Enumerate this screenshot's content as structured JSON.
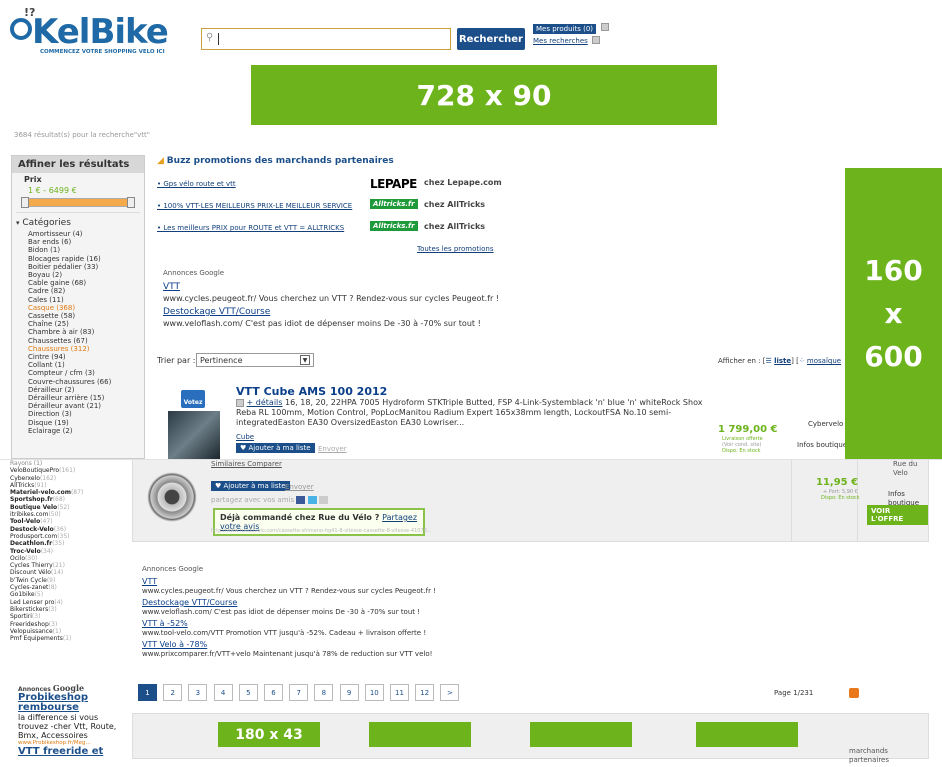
{
  "header": {
    "logo_text": "KelBike",
    "tagline": "COMMENCEZ VOTRE SHOPPING VELO ICI",
    "search_value": "",
    "search_button": "Rechercher",
    "my_products": "Mes produits (0)",
    "my_searches": "Mes recherches"
  },
  "ads": {
    "top_banner": "728 x 90",
    "sky_160": "160",
    "sky_x": "x",
    "sky_600": "600",
    "bottom_banner": "180 x 43"
  },
  "results_count": "3684 résultat(s) pour la recherche\"vtt\"",
  "sidebar": {
    "refine_title": "Affiner les résultats",
    "price_label": "Prix",
    "price_range": "1 € - 6499 €",
    "categories_title": "Catégories",
    "categories": [
      {
        "label": "Amortisseur (4)",
        "hl": false
      },
      {
        "label": "Bar ends (6)",
        "hl": false
      },
      {
        "label": "Bidon (1)",
        "hl": false
      },
      {
        "label": "Blocages rapide (16)",
        "hl": false
      },
      {
        "label": "Boitier pédalier (33)",
        "hl": false
      },
      {
        "label": "Boyau (2)",
        "hl": false
      },
      {
        "label": "Cable gaine (68)",
        "hl": false
      },
      {
        "label": "Cadre (82)",
        "hl": false
      },
      {
        "label": "Cales (11)",
        "hl": false
      },
      {
        "label": "Casque (368)",
        "hl": true
      },
      {
        "label": "Cassette (58)",
        "hl": false
      },
      {
        "label": "Chaîne (25)",
        "hl": false
      },
      {
        "label": "Chambre à air (83)",
        "hl": false
      },
      {
        "label": "Chaussettes (67)",
        "hl": false
      },
      {
        "label": "Chaussures (312)",
        "hl": true
      },
      {
        "label": "Cintre (94)",
        "hl": false
      },
      {
        "label": "Collant (1)",
        "hl": false
      },
      {
        "label": "Compteur / cfm (3)",
        "hl": false
      },
      {
        "label": "Couvre-chaussures (66)",
        "hl": false
      },
      {
        "label": "Dérailleur (2)",
        "hl": false
      },
      {
        "label": "Dérailleur arrière (15)",
        "hl": false
      },
      {
        "label": "Dérailleur avant (21)",
        "hl": false
      },
      {
        "label": "Direction (3)",
        "hl": false
      },
      {
        "label": "Disque (19)",
        "hl": false
      },
      {
        "label": "Eclairage (2)",
        "hl": false
      }
    ],
    "merchants_top_cut": "Rayons (1)",
    "merchants": [
      {
        "name": "VeloBoutiquePro",
        "count": "(161)",
        "bold": false
      },
      {
        "name": "Cyberxelo",
        "count": "(162)",
        "bold": false
      },
      {
        "name": "AllTricks",
        "count": "(91)",
        "bold": false
      },
      {
        "name": "Materiel-velo.com",
        "count": "(87)",
        "bold": true
      },
      {
        "name": "Sportshop.fr",
        "count": "(68)",
        "bold": true
      },
      {
        "name": "Boutique Velo",
        "count": "(52)",
        "bold": true
      },
      {
        "name": "itribikes.com",
        "count": "(50)",
        "bold": false
      },
      {
        "name": "Tool-Velo",
        "count": "(47)",
        "bold": true
      },
      {
        "name": "Destock-Velo",
        "count": "(36)",
        "bold": true
      },
      {
        "name": "Produsport.com",
        "count": "(35)",
        "bold": false
      },
      {
        "name": "Decathlon.fr",
        "count": "(35)",
        "bold": true
      },
      {
        "name": "Troc-Velo",
        "count": "(34)",
        "bold": true
      },
      {
        "name": "Ocilo",
        "count": "(30)",
        "bold": false
      },
      {
        "name": "Cycles Thierry",
        "count": "(21)",
        "bold": false
      },
      {
        "name": "Discount Vélo",
        "count": "(14)",
        "bold": false
      },
      {
        "name": "b'Twin Cycle",
        "count": "(9)",
        "bold": false
      },
      {
        "name": "Cycles-zanet",
        "count": "(8)",
        "bold": false
      },
      {
        "name": "Go1bike",
        "count": "(5)",
        "bold": false
      },
      {
        "name": "Led Lenser pro",
        "count": "(4)",
        "bold": false
      },
      {
        "name": "Bikerstickers",
        "count": "(3)",
        "bold": false
      },
      {
        "name": "Sportiri",
        "count": "(3)",
        "bold": false
      },
      {
        "name": "Freerideshop",
        "count": "(3)",
        "bold": false
      },
      {
        "name": "Velopuissance",
        "count": "(1)",
        "bold": false
      },
      {
        "name": "Pmf Equipements",
        "count": "(1)",
        "bold": false
      }
    ]
  },
  "buzz": {
    "title": "Buzz promotions des marchands partenaires",
    "items": [
      {
        "text": "• Gps vélo route et vtt",
        "brand": "LEPAPE",
        "chez": "chez Lepape.com"
      },
      {
        "text": "• 100% VTT-LES MEILLEURS PRIX-LE MEILLEUR SERVICE",
        "brand": "Alltricks.fr",
        "chez": "chez AllTricks"
      },
      {
        "text": "• Les meilleurs PRIX pour ROUTE et VTT = ALLTRICKS",
        "brand": "Alltricks.fr",
        "chez": "chez AllTricks"
      }
    ],
    "all_promos": "Toutes les promotions"
  },
  "google_ads_1": {
    "title": "Annonces Google",
    "ads": [
      {
        "title": "VTT",
        "line": "www.cycles.peugeot.fr/  Vous cherchez un VTT ? Rendez-vous sur cycles Peugeot.fr !"
      },
      {
        "title": "Destockage VTT/Course",
        "line": "www.veloflash.com/  C'est pas idiot de dépenser moins De -30 à -70% sur tout !"
      }
    ]
  },
  "sort": {
    "label": "Trier par :",
    "value": "Pertinence",
    "view_label": "Afficher en : [",
    "view_list": "liste",
    "view_sep": "] [",
    "view_mosaic": "mosaïque"
  },
  "product": {
    "vote": "Votez",
    "title": "VTT Cube AMS 100 2012",
    "details_link": "+ détails",
    "desc": "16, 18, 20, 22HPA 7005 Hydroform STKTriple Butted, FSP 4-Link-Systemblack 'n' blue 'n' whiteRock Shox Reba RL 100mm, Motion Control, PopLocManitou Radium Expert 165x38mm length, LockoutFSA No.10 semi-integratedEaston EA30 OversizedEaston EA30 Lowriser...",
    "brand": "Cube",
    "add_list": "♥ Ajouter à ma liste",
    "send": "Envoyer",
    "price": "1 799,00 €",
    "shipping": "Livraison offerte",
    "ship_note": "(Voir cond. site)",
    "stock": "Dispo: En stock",
    "merchant": "Cybervelo",
    "merchant_info": "Infos boutique"
  },
  "product2": {
    "top_links": "Similaires   Comparer",
    "add_list": "♥ Ajouter à ma liste",
    "send": "Envoyer",
    "share": "partagez avec vos amis",
    "already": "Déjà commandé chez Rue du Vélo ?",
    "share_opinion": "Partagez votre avis",
    "url": "http://www.rueduvelo.com/cassette-shimano-hg41-8-vitesse-cassette-8-vitesse-41078...",
    "price": "11,95 €",
    "shipping": "+ Port: 5,90 €",
    "stock": "Dispo: En stock",
    "merchant_top": "Rue du Velo",
    "merchant_info": "Infos boutique",
    "offer_btn": "VOIR L'OFFRE"
  },
  "google_ads_2": {
    "title": "Annonces Google",
    "ads": [
      {
        "title": "VTT",
        "line": "www.cycles.peugeot.fr/  Vous cherchez un VTT ? Rendez-vous sur cycles Peugeot.fr !"
      },
      {
        "title": "Destockage VTT/Course",
        "line": "www.veloflash.com/  C'est pas idiot de dépenser moins De -30 à -70% sur tout !"
      },
      {
        "title": "VTT à -52%",
        "line": "www.tool-velo.com/VTT  Promotion VTT jusqu'à -52%. Cadeau + livraison offerte !"
      },
      {
        "title": "VTT Velo à -78%",
        "line": "www.prixcomparer.fr/VTT+velo  Maintenant jusqu'à 78% de reduction sur VTT velo!"
      }
    ]
  },
  "left_google": {
    "label": "Annonces",
    "brand": "Google",
    "title": "Probikeshop rembourse",
    "text": "la difference si vous trouvez -cher Vtt, Route, Bmx, Accessoires",
    "url": "www.Probikeshop.fr/Meg...",
    "next_title": "VTT freeride et"
  },
  "pagination": {
    "pages": [
      "1",
      "2",
      "3",
      "4",
      "5",
      "6",
      "7",
      "8",
      "9",
      "10",
      "11",
      "12",
      ">"
    ],
    "page_info": "Page 1/231"
  },
  "partners_label": "marchands partenaires"
}
